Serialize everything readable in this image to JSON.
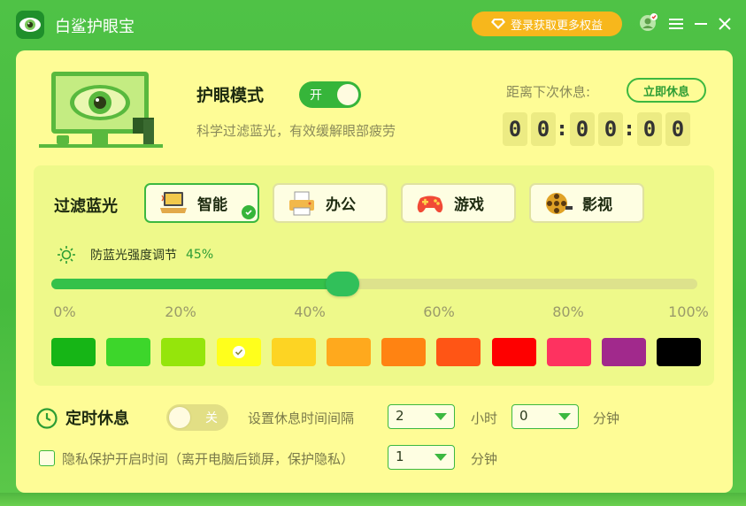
{
  "app": {
    "title": "白鲨护眼宝",
    "login_label": "登录获取更多权益"
  },
  "eye_mode": {
    "title": "护眼模式",
    "toggle_label": "开",
    "subtitle": "科学过滤蓝光，有效缓解眼部疲劳",
    "next_rest_label": "距离下次休息:",
    "rest_now_label": "立即休息",
    "countdown": {
      "h1": "0",
      "h2": "0",
      "m1": "0",
      "m2": "0",
      "s1": "0",
      "s2": "0",
      "sep": ":"
    }
  },
  "filter": {
    "title": "过滤蓝光",
    "modes": [
      {
        "label": "智能",
        "icon": "laptop-icon",
        "active": true
      },
      {
        "label": "办公",
        "icon": "printer-icon",
        "active": false
      },
      {
        "label": "游戏",
        "icon": "gamepad-icon",
        "active": false
      },
      {
        "label": "影视",
        "icon": "film-reel-icon",
        "active": false
      }
    ],
    "intensity_label": "防蓝光强度调节",
    "intensity_value": "45%",
    "intensity": 45,
    "ticks": [
      "0%",
      "20%",
      "40%",
      "60%",
      "80%",
      "100%"
    ],
    "swatches": [
      "#16b516",
      "#3dd62b",
      "#95e50b",
      "#ffff1c",
      "#fdd423",
      "#ffa91d",
      "#ff8312",
      "#ff5515",
      "#fe0000",
      "#fe3260",
      "#a1298c",
      "#000000"
    ],
    "selected_swatch": 3
  },
  "timer": {
    "title": "定时休息",
    "toggle_label": "关",
    "interval_label": "设置休息时间间隔",
    "hours_value": "2",
    "hours_unit": "小时",
    "minutes_value": "0",
    "minutes_unit": "分钟",
    "privacy_label": "隐私保护开启时间（离开电脑后锁屏，保护隐私）",
    "privacy_value": "1",
    "privacy_unit": "分钟"
  },
  "colors": {
    "accent": "#36b53a",
    "panel": "#fefc96",
    "login": "#f7b71c"
  }
}
